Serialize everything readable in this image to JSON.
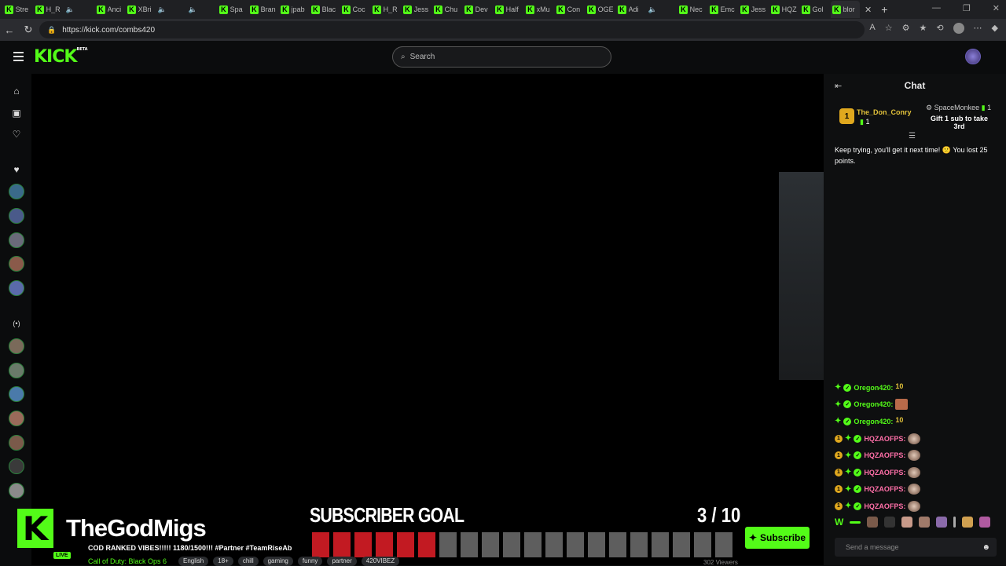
{
  "browser": {
    "tabs": [
      "Stre",
      "H_R",
      "",
      "Anci",
      "XBri",
      "",
      "",
      "Spa",
      "Bran",
      "jpab",
      "Blac",
      "Coc",
      "H_R",
      "Jess",
      "Chu",
      "Dev",
      "Half",
      "xMu",
      "Con",
      "OGE",
      "Adi",
      "",
      "Nec",
      "Emc",
      "Jess",
      "HQZ",
      "Gol",
      "blor"
    ],
    "close_label": "✕",
    "new_tab_label": "+",
    "url": "https://kick.com/combs420"
  },
  "kick": {
    "logo": "KICK",
    "logo_beta": "BETA",
    "search_placeholder": "Search"
  },
  "stream": {
    "overlay_name": "TheGodMigs",
    "subscriber_goal_label": "SUBSCRIBER GOAL",
    "subscriber_goal_count": "3 / 10",
    "goal_current": 6,
    "goal_total": 20,
    "live_badge": "LIVE",
    "title": "COD RANKED VIBES!!!!! 1180/1500!!! #Partner #TeamRiseAb",
    "category": "Call of Duty: Black Ops 6",
    "tags": [
      "English",
      "18+",
      "chill",
      "gaming",
      "funny",
      "partner",
      "420VIBEZ"
    ],
    "viewers": "302 Viewers",
    "subscribe_label": "Subscribe"
  },
  "chat": {
    "title": "Chat",
    "leaderboard": {
      "first_rank": "1",
      "first_name": "The_Don_Conry",
      "first_count": "1",
      "second_name": "SpaceMonkee",
      "second_count": "1",
      "second_cta": "Gift 1 sub to take 3rd"
    },
    "pinned_message": "Keep trying, you'll get it next time! 😕 You lost 25 points.",
    "messages": [
      {
        "user": "Oregon420:",
        "color": "#53fc18",
        "gold": false,
        "emote": "10"
      },
      {
        "user": "Oregon420:",
        "color": "#53fc18",
        "gold": false,
        "emote": ""
      },
      {
        "user": "Oregon420:",
        "color": "#53fc18",
        "gold": false,
        "emote": "10"
      },
      {
        "user": "HQZAOFPS:",
        "color": "#ff6fa8",
        "gold": true,
        "emote": ""
      },
      {
        "user": "HQZAOFPS:",
        "color": "#ff6fa8",
        "gold": true,
        "emote": ""
      },
      {
        "user": "HQZAOFPS:",
        "color": "#ff6fa8",
        "gold": true,
        "emote": ""
      },
      {
        "user": "HQZAOFPS:",
        "color": "#ff6fa8",
        "gold": true,
        "emote": ""
      },
      {
        "user": "HQZAOFPS:",
        "color": "#ff6fa8",
        "gold": true,
        "emote": ""
      }
    ],
    "input_placeholder": "Send a message"
  }
}
